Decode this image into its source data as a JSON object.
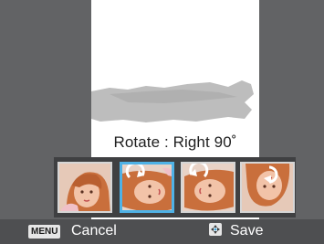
{
  "caption": {
    "rotate_text": "Rotate : Right 90˚"
  },
  "thumbnails": [
    {
      "name": "original",
      "arrow": "none",
      "selected": false
    },
    {
      "name": "rotate-right",
      "arrow": "rotate-right-icon",
      "selected": true
    },
    {
      "name": "rotate-left",
      "arrow": "rotate-left-icon",
      "selected": false
    },
    {
      "name": "rotate-180",
      "arrow": "rotate-180-icon",
      "selected": false
    }
  ],
  "bottom_bar": {
    "menu_key": "MENU",
    "cancel_label": "Cancel",
    "dpad_icon": "dpad-icon",
    "save_label": "Save"
  },
  "colors": {
    "selection_border": "#4fb2e6",
    "preview_background": "#ffffff",
    "side_panels": "#626365"
  }
}
